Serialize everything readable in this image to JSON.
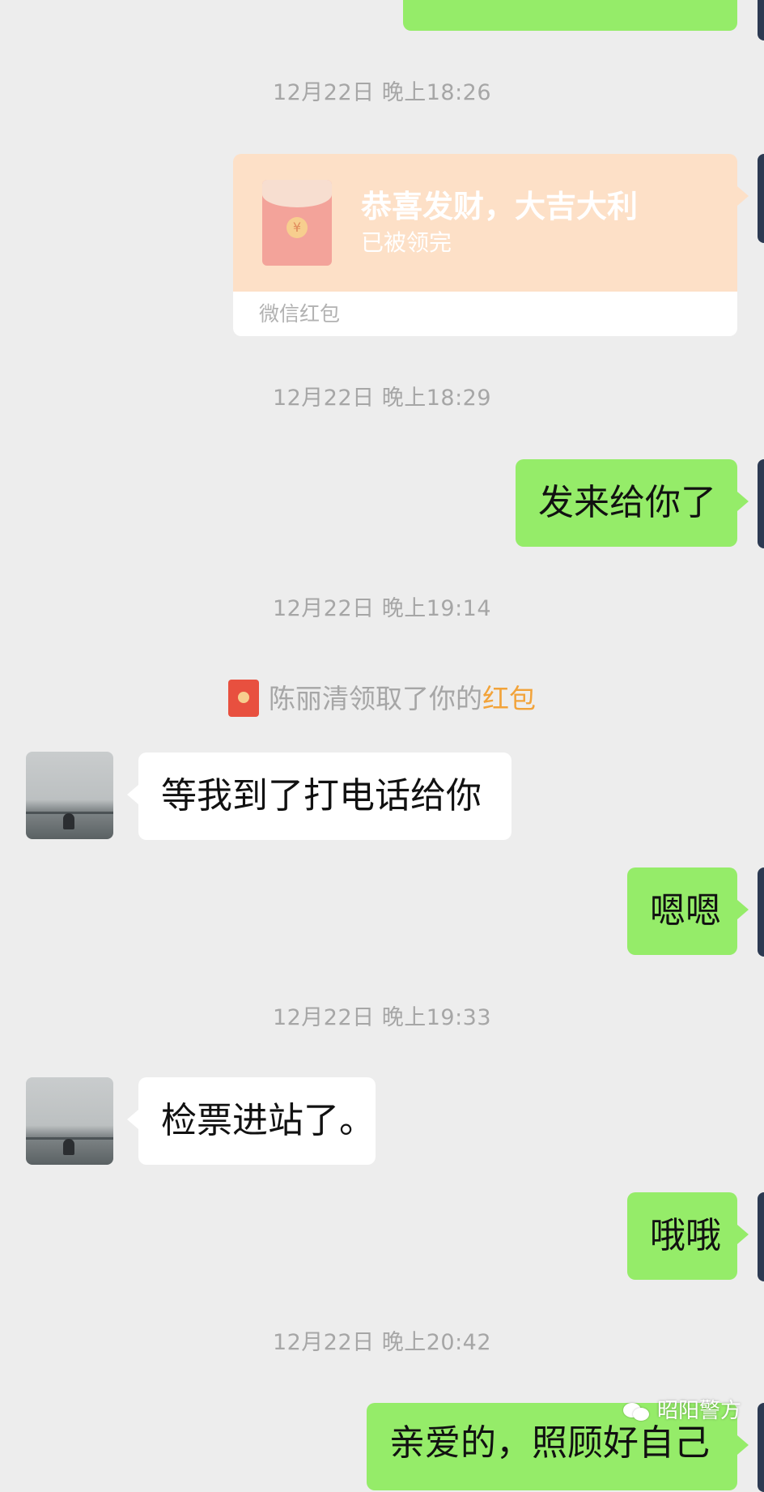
{
  "messages": {
    "top_partial_bubble": "",
    "t1": "12月22日 晚上18:26",
    "red_packet": {
      "title": "恭喜发财，大吉大利",
      "status": "已被领完",
      "footer": "微信红包"
    },
    "t2": "12月22日 晚上18:29",
    "m1": "发来给你了",
    "t3": "12月22日 晚上19:14",
    "notice": {
      "text": "陈丽清领取了你的",
      "link": "红包"
    },
    "m2": "等我到了打电话给你",
    "m3": "嗯嗯",
    "t4": "12月22日 晚上19:33",
    "m4": "检票进站了。",
    "m5": "哦哦",
    "t5": "12月22日 晚上20:42",
    "m6": "亲爱的，照顾好自己"
  },
  "watermark": {
    "text": "昭阳警方"
  },
  "colors": {
    "background": "#ededed",
    "self_bubble": "#95ec69",
    "other_bubble": "#ffffff",
    "red_packet_bg": "#fde0c7",
    "link": "#f2a33a"
  }
}
